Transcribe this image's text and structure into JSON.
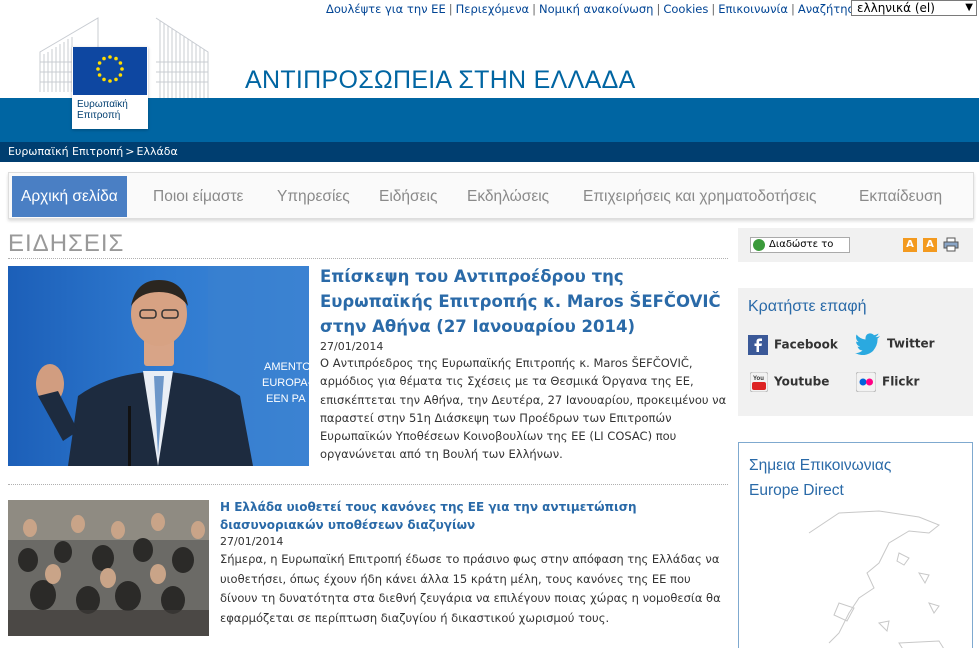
{
  "top_links": [
    "Δουλέψτε για την ΕΕ",
    "Περιεχόμενα",
    "Νομική ανακοίνωση",
    "Cookies",
    "Επικοινωνία",
    "Αναζήτηση"
  ],
  "language": {
    "selected": "ελληνικά (el)",
    "arrow": "▼"
  },
  "logo": {
    "line1": "Ευρωπαϊκή",
    "line2": "Επιτροπή"
  },
  "site_title": "ΑΝΤΙΠΡΟΣΩΠΕΙΑ ΣΤΗΝ ΕΛΛΑΔΑ",
  "breadcrumb": {
    "first": "Ευρωπαϊκή Επιτροπή",
    "sep": ">",
    "second": "Ελλάδα"
  },
  "nav": [
    "Αρχική σελίδα",
    "Ποιοι είμαστε",
    "Υπηρεσίες",
    "Ειδήσεις",
    "Εκδηλώσεις",
    "Επιχειρήσεις και χρηματοδοτήσεις",
    "Εκπαίδευση"
  ],
  "section_title": "ΕΙΔΗΣΕΙΣ",
  "articles": [
    {
      "title": "Επίσκεψη του Αντιπροέδρου της Ευρωπαϊκής Επιτροπής κ. Maros ŠEFČOVIČ στην Αθήνα (27 Ιανουαρίου 2014)",
      "date": "27/01/2014",
      "body": "Ο Αντιπρόεδρος της Ευρωπαϊκής Επιτροπής κ. Maros ŠEFČOVIČ, αρμόδιος για θέματα τις Σχέσεις με τα Θεσμικά Όργανα της ΕΕ, επισκέπτεται την Αθήνα, την Δευτέρα, 27 Ιανουαρίου, προκειμένου να παραστεί στην 51η Διάσκεψη των Προέδρων των Επιτροπών Ευρωπαϊκών Υποθέσεων Κοινοβουλίων της ΕΕ (LI COSAC) που οργανώνεται από τη Βουλή των Ελλήνων.",
      "photo_text": "AMENTO\nEUROPA-P\nEEN PA"
    },
    {
      "title": "Η Ελλάδα υιοθετεί τους κανόνες της ΕΕ για την αντιμετώπιση διασυνοριακών υποθέσεων διαζυγίων",
      "date": "27/01/2014",
      "body": "Σήμερα, η Ευρωπαϊκή Επιτροπή έδωσε το πράσινο φως στην απόφαση της Ελλάδας να υιοθετήσει, όπως έχουν ήδη κάνει άλλα 15 κράτη μέλη, τους κανόνες της ΕΕ που δίνουν τη δυνατότητα στα διεθνή ζευγάρια να επιλέγουν ποιας χώρας η νομοθεσία θα εφαρμόζεται σε περίπτωση διαζυγίου ή δικαστικού χωρισμού τους."
    }
  ],
  "sidebar": {
    "share_label": "Διαδώστε το",
    "font_small": "A",
    "font_large": "A",
    "contact_title": "Κρατήστε επαφή",
    "social": {
      "facebook": "Facebook",
      "twitter": "Twitter",
      "youtube": "Youtube",
      "flickr": "Flickr"
    },
    "europe_title_line1": "Σημεια Επικοινωνιας",
    "europe_title_line2": "Europe Direct"
  },
  "colors": {
    "brand_blue": "#0065a2",
    "dark_blue": "#003e70",
    "link_blue": "#2a6aa8",
    "active_nav": "#4a7fc4"
  },
  "icons": [
    "share-icon",
    "print-icon",
    "facebook-icon",
    "twitter-icon",
    "youtube-icon",
    "flickr-icon",
    "eu-flag-icon"
  ]
}
